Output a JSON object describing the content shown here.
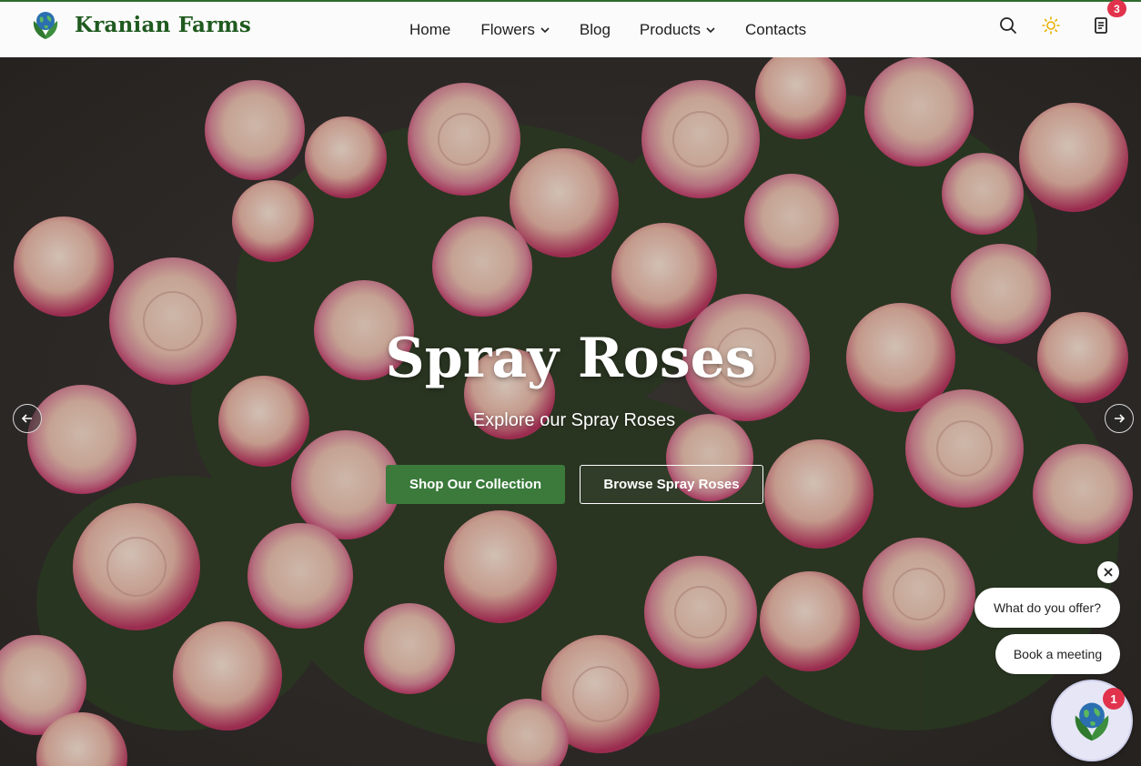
{
  "brand": {
    "name": "Kranian Farms",
    "logo_icon": "globe-leaf-icon"
  },
  "nav": {
    "home": "Home",
    "flowers": "Flowers",
    "blog": "Blog",
    "products": "Products",
    "contacts": "Contacts"
  },
  "header_icons": {
    "search": "search-icon",
    "theme": "sun-icon",
    "cart": "cart-icon",
    "cart_count": "3"
  },
  "hero": {
    "title": "Spray Roses",
    "subtitle": "Explore our Spray Roses",
    "primary_cta": "Shop Our Collection",
    "secondary_cta": "Browse Spray Roses",
    "prev_icon": "arrow-left-icon",
    "next_icon": "arrow-right-icon"
  },
  "chat": {
    "prompt_1": "What do you offer?",
    "prompt_2": "Book a meeting",
    "unread_count": "1",
    "close_icon": "close-icon"
  },
  "colors": {
    "brand_green": "#3b7a3b",
    "badge_red": "#e2334d",
    "logo_text": "#1f5a1f"
  }
}
